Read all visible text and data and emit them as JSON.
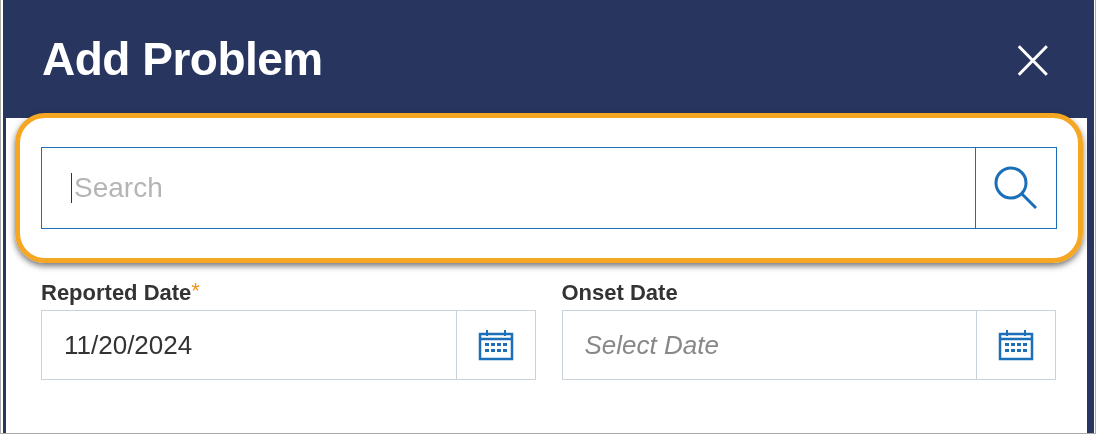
{
  "dialog": {
    "title": "Add Problem",
    "close": "×"
  },
  "search": {
    "placeholder": "Search",
    "focused": true
  },
  "fields": [
    {
      "label": "Reported Date",
      "required_mark": "*",
      "value": "11/20/2024"
    },
    {
      "label": "Onset Date",
      "placeholder": "Select Date"
    }
  ]
}
